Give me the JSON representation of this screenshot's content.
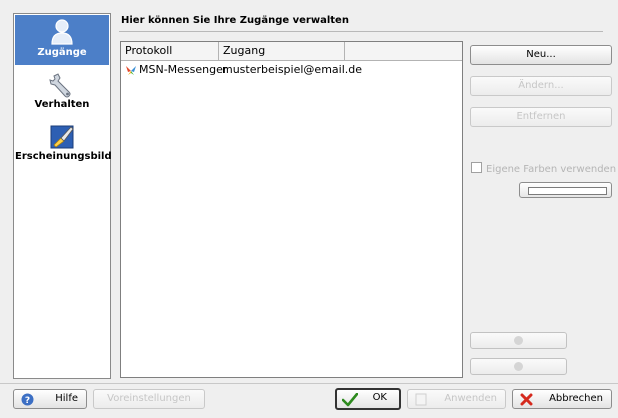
{
  "header": {
    "title": "Hier können Sie Ihre Zugänge verwalten"
  },
  "sidebar": {
    "items": [
      {
        "label": "Zugänge",
        "icon": "user-icon",
        "selected": true
      },
      {
        "label": "Verhalten",
        "icon": "wrench-icon",
        "selected": false
      },
      {
        "label": "Erscheinungsbild",
        "icon": "appearance-icon",
        "selected": false
      }
    ]
  },
  "accounts": {
    "columns": [
      "Protokoll",
      "Zugang"
    ],
    "rows": [
      {
        "protocol": "MSN-Messenger",
        "account": "musterbeispiel@email.de",
        "icon": "msn-butterfly-icon"
      }
    ]
  },
  "actions": {
    "new_label": "Neu...",
    "change_label": "Ändern...",
    "remove_label": "Entfernen"
  },
  "colors_option": {
    "label": "Eigene Farben verwenden",
    "checked": false
  },
  "footer": {
    "help_label": "Hilfe",
    "defaults_label": "Voreinstellungen",
    "ok_label": "OK",
    "apply_label": "Anwenden",
    "cancel_label": "Abbrechen"
  },
  "theme": {
    "selection": "#4c7fc8",
    "cancel_red": "#d52a1e",
    "ok_green": "#2d8a1e"
  }
}
